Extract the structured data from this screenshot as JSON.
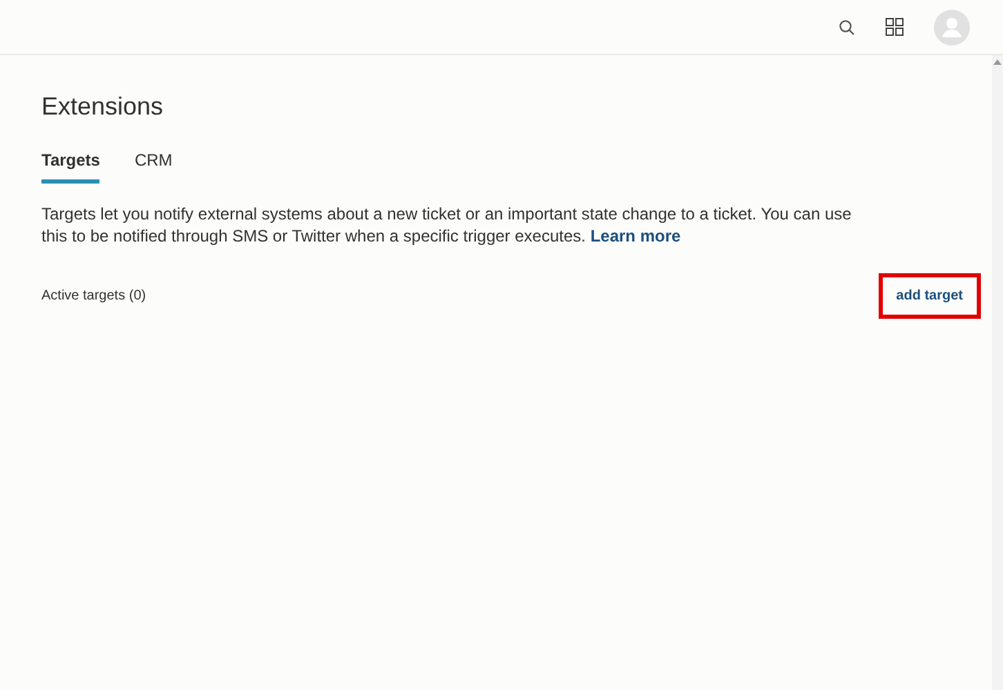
{
  "page": {
    "title": "Extensions"
  },
  "tabs": [
    {
      "label": "Targets",
      "selected": true
    },
    {
      "label": "CRM",
      "selected": false
    }
  ],
  "description": {
    "text": "Targets let you notify external systems about a new ticket or an important state change to a ticket. You can use this to be notified through SMS or Twitter when a specific trigger executes.",
    "link": "Learn more"
  },
  "active_targets": {
    "label": "Active targets (0)"
  },
  "add_button": {
    "label": "add target",
    "highlighted": true
  }
}
